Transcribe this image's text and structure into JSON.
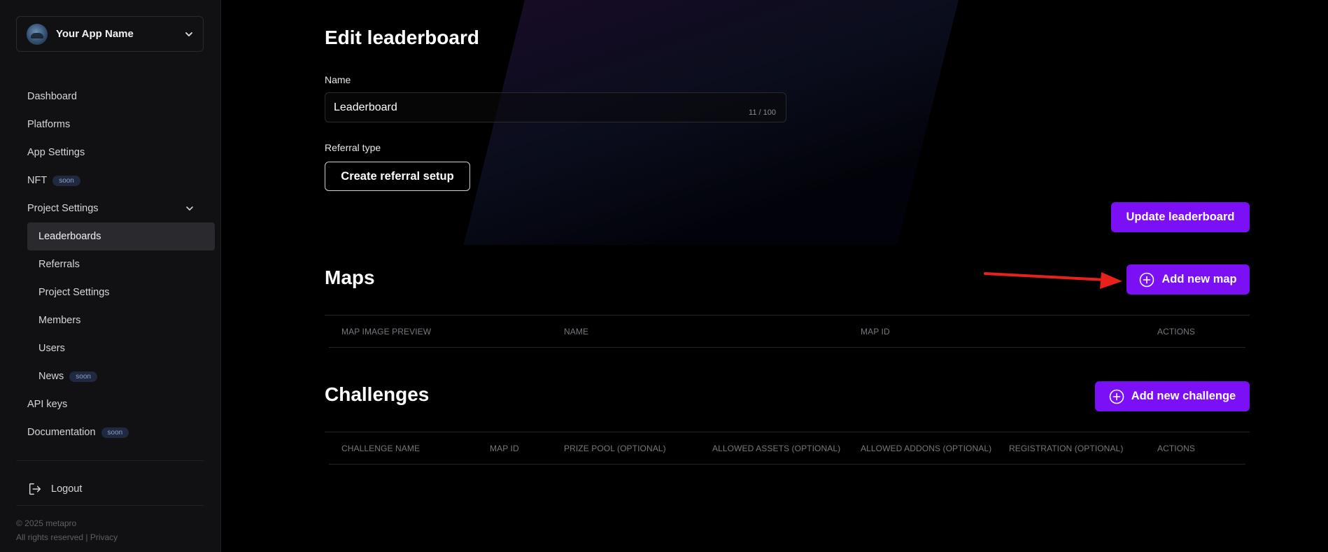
{
  "app": {
    "name": "Your App Name"
  },
  "sidebar": {
    "items": [
      {
        "label": "Dashboard"
      },
      {
        "label": "Platforms"
      },
      {
        "label": "App Settings"
      },
      {
        "label": "NFT",
        "badge": "soon"
      },
      {
        "label": "Project Settings"
      },
      {
        "label": "Leaderboards"
      },
      {
        "label": "Referrals"
      },
      {
        "label": "Project Settings"
      },
      {
        "label": "Members"
      },
      {
        "label": "Users"
      },
      {
        "label": "News",
        "badge": "soon"
      },
      {
        "label": "API keys"
      },
      {
        "label": "Documentation",
        "badge": "soon"
      }
    ],
    "logout": "Logout",
    "footer": {
      "copyright": "© 2025 metapro",
      "rights": "All rights reserved |",
      "privacy": "Privacy"
    }
  },
  "main": {
    "title": "Edit leaderboard",
    "name_label": "Name",
    "name_value": "Leaderboard",
    "name_count": "11 / 100",
    "referral_label": "Referral type",
    "referral_button": "Create referral setup",
    "update_button": "Update leaderboard",
    "maps": {
      "title": "Maps",
      "add_button": "Add new map",
      "columns": [
        "MAP IMAGE PREVIEW",
        "NAME",
        "MAP ID",
        "ACTIONS"
      ]
    },
    "challenges": {
      "title": "Challenges",
      "add_button": "Add new challenge",
      "columns": [
        "CHALLENGE NAME",
        "MAP ID",
        "PRIZE POOL (OPTIONAL)",
        "ALLOWED ASSETS (OPTIONAL)",
        "ALLOWED ADDONS (OPTIONAL)",
        "REGISTRATION (OPTIONAL)",
        "ACTIONS"
      ]
    }
  },
  "colors": {
    "accent": "#7b0ff5",
    "arrow": "#e8221b",
    "background": "#000000",
    "sidebar": "#111113"
  }
}
